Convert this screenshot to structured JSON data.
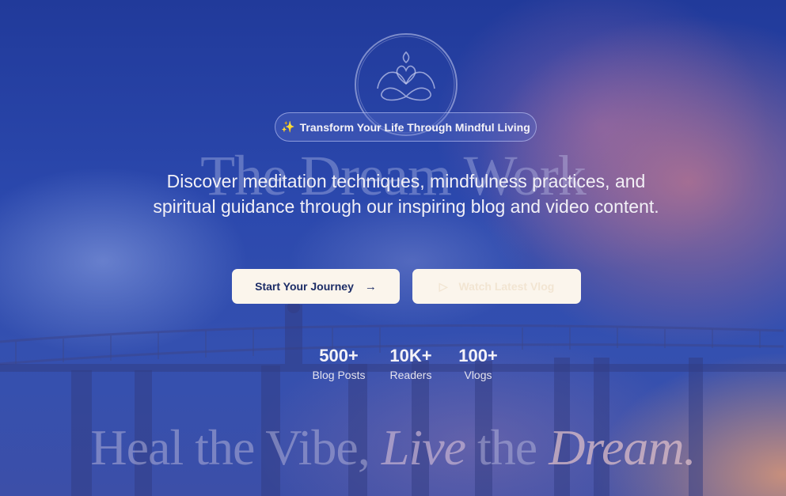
{
  "hero": {
    "badge": {
      "icon": "sparkles-icon",
      "text": "Transform Your Life Through Mindful Living"
    },
    "site_title": "The Dream Work",
    "description": "Discover meditation techniques, mindfulness practices, and spiritual guidance through our inspiring blog and video content.",
    "buttons": {
      "primary_label": "Start Your Journey",
      "primary_icon": "arrow-right-icon",
      "secondary_label": "Watch Latest Vlog",
      "secondary_icon": "play-icon"
    },
    "stats": [
      {
        "value": "500+",
        "label": "Blog Posts"
      },
      {
        "value": "10K+",
        "label": "Readers"
      },
      {
        "value": "100+",
        "label": "Vlogs"
      }
    ],
    "tagline": {
      "part1": "Heal the Vibe,",
      "part2": "Live",
      "part3": "the",
      "part4": "Dream."
    }
  },
  "colors": {
    "background": "#2a3e9a",
    "button_bg": "#fbf5ec",
    "button_text": "#1c2c66",
    "badge_star": "#f5c55a"
  }
}
